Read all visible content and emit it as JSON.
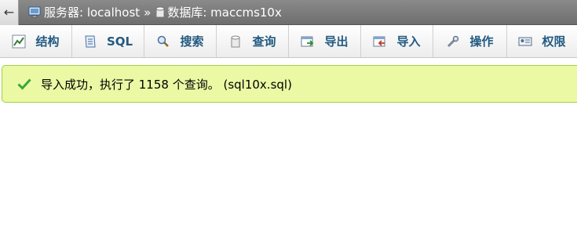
{
  "breadcrumb": {
    "back_glyph": "←",
    "server": "服务器: localhost",
    "separator": "»",
    "database": "数据库: maccms10x"
  },
  "tabs": [
    {
      "label": "结构",
      "icon": "structure-icon"
    },
    {
      "label": "SQL",
      "icon": "sql-icon"
    },
    {
      "label": "搜索",
      "icon": "search-icon"
    },
    {
      "label": "查询",
      "icon": "query-icon"
    },
    {
      "label": "导出",
      "icon": "export-icon"
    },
    {
      "label": "导入",
      "icon": "import-icon"
    },
    {
      "label": "操作",
      "icon": "wrench-icon"
    },
    {
      "label": "权限",
      "icon": "privileges-icon"
    }
  ],
  "message": {
    "type": "success",
    "icon": "checkmark-icon",
    "text": "导入成功，执行了 1158 个查询。 (sql10x.sql)"
  },
  "colors": {
    "tab_text": "#235a81",
    "success_bg": "#ebf8a4",
    "success_border": "#a2d246",
    "topbar": "#7a7a7a"
  }
}
